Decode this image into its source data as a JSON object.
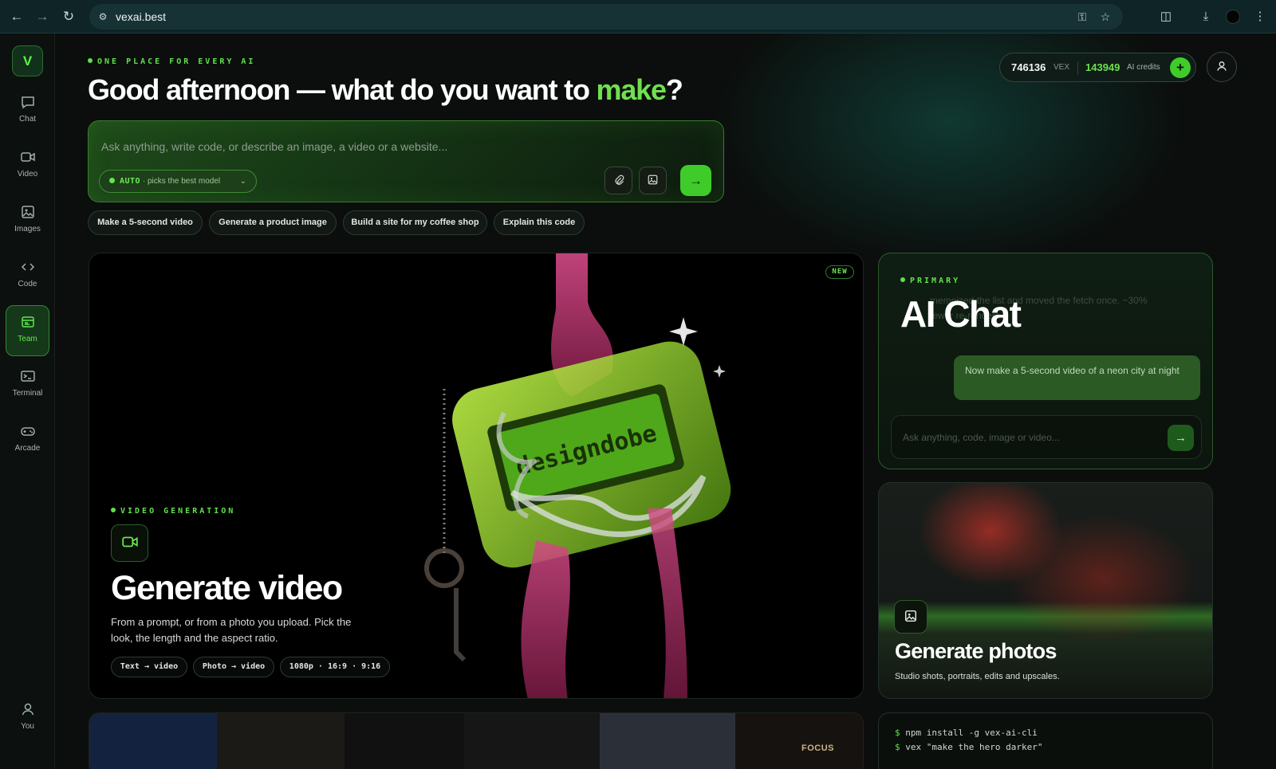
{
  "browser": {
    "url": "vexai.best",
    "icons": [
      "back-icon",
      "forward-icon",
      "reload-icon",
      "site-info-icon",
      "password-key-icon",
      "bookmark-star-icon",
      "extensions-icon",
      "download-icon",
      "profile-icon",
      "more-menu-icon"
    ]
  },
  "sidebar": {
    "logo": "V",
    "items": [
      {
        "label": "Chat",
        "icon": "chat-icon"
      },
      {
        "label": "Video",
        "icon": "video-icon"
      },
      {
        "label": "Images",
        "icon": "image-icon"
      },
      {
        "label": "Code",
        "icon": "code-icon"
      },
      {
        "label": "Team",
        "icon": "team-icon",
        "active": true
      },
      {
        "label": "Terminal",
        "icon": "terminal-icon"
      },
      {
        "label": "Arcade",
        "icon": "gamepad-icon"
      }
    ],
    "you_label": "You"
  },
  "header": {
    "eyebrow": "ONE PLACE FOR EVERY AI",
    "headline_prefix": "Good afternoon — what do you want to ",
    "headline_accent": "make",
    "headline_suffix": "?"
  },
  "prompt": {
    "placeholder": "Ask anything, write code, or describe an image, a video or a website...",
    "model_mode": "AUTO",
    "model_hint": "· picks the best model",
    "send_icon": "arrow-right-icon"
  },
  "suggestions": [
    "Make a 5-second video",
    "Generate a product image",
    "Build a site for my coffee shop",
    "Explain this code"
  ],
  "credits": {
    "vex_amount": "746136",
    "vex_unit": "VEX",
    "ai_amount": "143949",
    "ai_unit": "AI credits"
  },
  "video_card": {
    "badge": "NEW",
    "eyebrow": "VIDEO GENERATION",
    "title": "Generate video",
    "description": "From a prompt, or from a photo you upload. Pick the look, the length and the aspect ratio.",
    "tags": [
      "Text → video",
      "Photo → video",
      "1080p · 16:9 · 9:16"
    ],
    "screen_text": "designdobe"
  },
  "chat_card": {
    "eyebrow": "PRIMARY",
    "title": "AI Chat",
    "ghost_message": "memoized the list and moved the fetch once. ~30% fewer re-renders.",
    "user_message": "Now make a 5-second video of a neon city at night",
    "input_placeholder": "Ask anything, code, image or video..."
  },
  "photo_card": {
    "title": "Generate photos",
    "description": "Studio shots, portraits, edits and upscales."
  },
  "sites_strip": {
    "focus_text": "FOCUS"
  },
  "terminal": {
    "lines": [
      "npm install -g vex-ai-cli",
      "vex \"make the hero darker\""
    ],
    "prompt_symbol": "$"
  },
  "colors": {
    "accent": "#5fe14b",
    "send_button": "#3fcc2a",
    "background": "#0b0e0c"
  }
}
